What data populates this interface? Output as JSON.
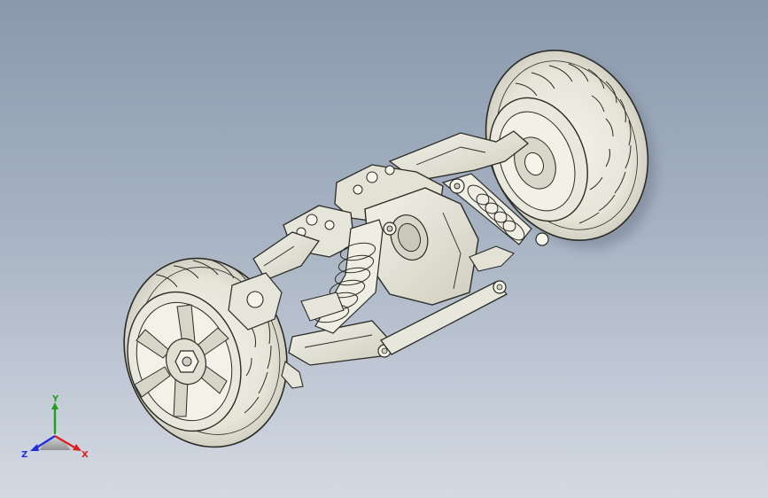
{
  "viewport": {
    "background_top": "#8a99ae",
    "background_bottom": "#d4dae3",
    "model_fill": "#ecebdf",
    "model_edge": "#2b2b26",
    "model_shadow": "#bdbcae"
  },
  "model": {
    "components": [
      "front-wheel",
      "rear-wheel",
      "chassis-housing",
      "front-shock-absorber",
      "rear-shock-absorber",
      "upper-control-arm",
      "lower-control-arm",
      "steering-link"
    ]
  },
  "triad": {
    "x_label": "X",
    "y_label": "Y",
    "z_label": "Z",
    "x_color": "#e02020",
    "y_color": "#1ea01e",
    "z_color": "#2030e0"
  }
}
